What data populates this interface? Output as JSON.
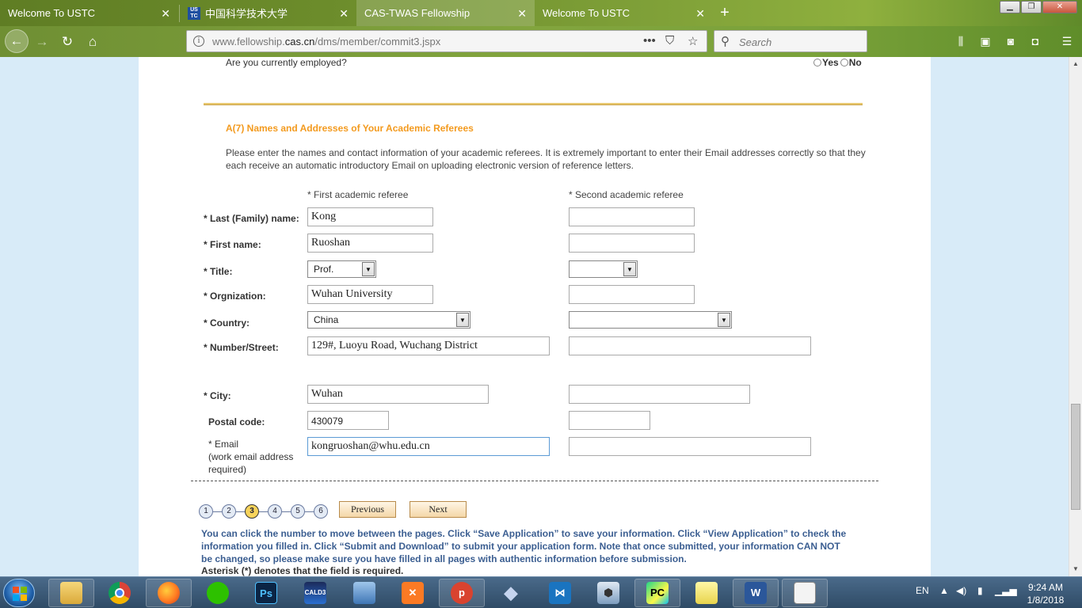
{
  "browser": {
    "tabs": [
      {
        "label": "Welcome To USTC",
        "active": false
      },
      {
        "label": "中国科学技术大学",
        "active": false,
        "favicon": "USTC"
      },
      {
        "label": "CAS-TWAS Fellowship",
        "active": true
      },
      {
        "label": "Welcome To USTC",
        "active": false
      }
    ],
    "url_prefix": "www.fellowship.",
    "url_domain": "cas.cn",
    "url_path": "/dms/member/commit3.jspx",
    "search_placeholder": "Search",
    "icons": [
      "back-icon",
      "forward-icon",
      "reload-icon",
      "home-icon",
      "info-icon",
      "more-icon",
      "pocket-icon",
      "bookmark-star-icon",
      "search-icon",
      "library-icon",
      "sidebar-icon",
      "extension-icon",
      "screenshot-icon",
      "menu-icon"
    ]
  },
  "page": {
    "employed_question": "Are you currently employed?",
    "yes_label": "Yes",
    "no_label": "No",
    "section_title": "A(7) Names and Addresses of Your Academic Referees",
    "section_desc": "Please enter the names and contact information of your academic referees. It is extremely important to enter their Email addresses correctly so that they each receive an automatic introductory Email on uploading electronic version of reference letters.",
    "col_first": "* First academic referee",
    "col_second": "* Second academic referee",
    "labels": {
      "last_name": "* Last (Family) name:",
      "first_name": "* First name:",
      "title": "* Title:",
      "organization": "* Orgnization:",
      "country": "* Country:",
      "street": "* Number/Street:",
      "city": "* City:",
      "postal": "Postal code:",
      "email_1": "* Email",
      "email_2": "(work email address",
      "email_3": "required)"
    },
    "referee1": {
      "last_name": "Kong",
      "first_name": "Ruoshan",
      "title": "Prof.",
      "organization": "Wuhan University",
      "country": "China",
      "street": "129#, Luoyu Road, Wuchang District",
      "city": "Wuhan",
      "postal": "430079",
      "email": "kongruoshan@whu.edu.cn"
    },
    "referee2": {
      "last_name": "",
      "first_name": "",
      "title": "",
      "organization": "",
      "country": "",
      "street": "",
      "city": "",
      "postal": "",
      "email": ""
    },
    "pager": {
      "pages": [
        "1",
        "2",
        "3",
        "4",
        "5",
        "6"
      ],
      "current": "3",
      "previous_label": "Previous",
      "next_label": "Next"
    },
    "note": "You can click the number to move between the pages. Click “Save Application” to save your information. Click “View Application” to check the information you filled in. Click “Submit and Download” to submit your application form. Note that once submitted, your information CAN NOT be changed, so please make sure you have filled in all pages with authentic information before submission.",
    "note2": "Asterisk (*) denotes that the field is required.",
    "colors": {
      "section_title": "#f39a1e",
      "note": "#3b5e91",
      "gold_line": "#e8c870"
    }
  },
  "taskbar": {
    "apps": [
      "windows-explorer-icon",
      "chrome-icon",
      "firefox-icon",
      "wechat-icon",
      "photoshop-icon",
      "cald3-icon",
      "virtualbox-icon",
      "xampp-icon",
      "pomodoro-icon",
      "ethereum-icon",
      "vscode-icon",
      "sketchup-icon",
      "pycharm-icon",
      "sticky-notes-icon",
      "word-icon",
      "presentation-icon"
    ],
    "photoshop_label": "Ps",
    "cald3_label": "CALD3",
    "pycharm_label": "PC",
    "word_label": "W",
    "language": "EN",
    "time": "9:24 AM",
    "date": "1/8/2018"
  }
}
